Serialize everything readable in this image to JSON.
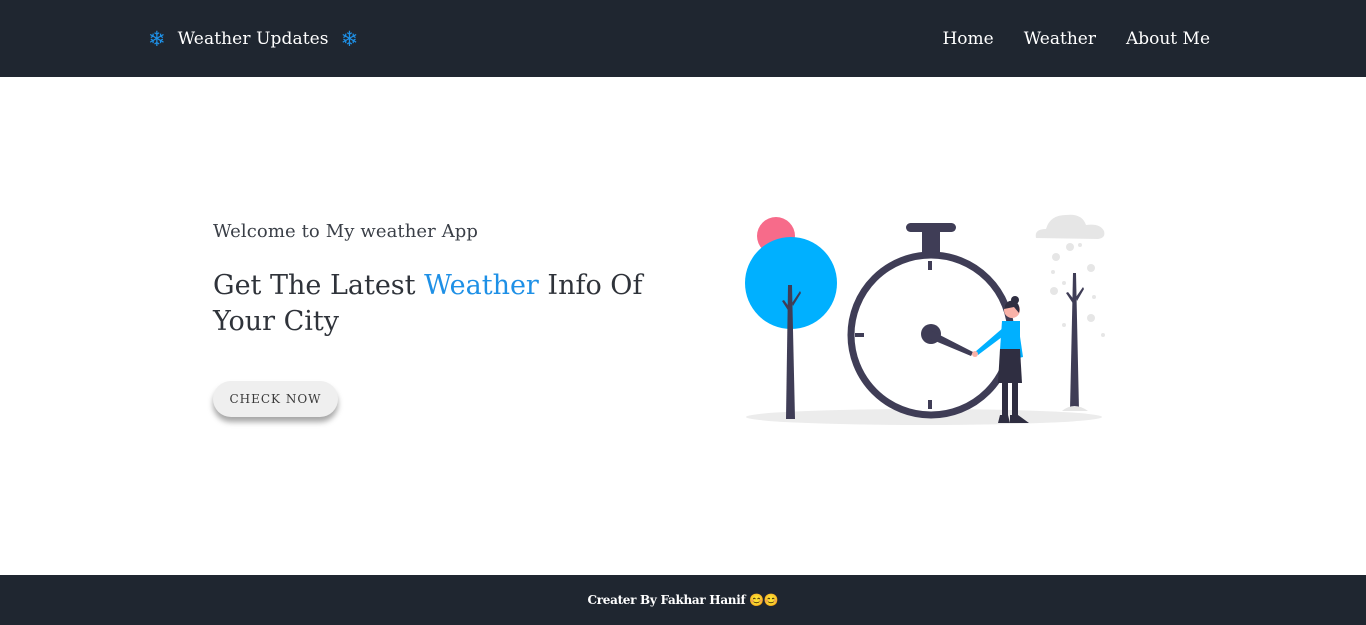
{
  "header": {
    "brand_icon": "snowflake-icon",
    "brand_icon_glyph": "❄",
    "brand_title": "Weather Updates",
    "nav": [
      {
        "label": "Home"
      },
      {
        "label": "Weather"
      },
      {
        "label": "About Me"
      }
    ]
  },
  "hero": {
    "welcome": "Welcome to My weather App",
    "headline_part1": "Get The Latest ",
    "headline_accent": "Weather",
    "headline_part2": " Info Of Your City",
    "button_label": "CHECK NOW",
    "illustration": "stopwatch-with-woman-and-trees-illustration"
  },
  "footer": {
    "text": "Creater By Fakhar Hanif 😊😊"
  },
  "colors": {
    "nav_background": "#1f2630",
    "accent": "#1e90e6",
    "illustration_blue": "#00b0ff",
    "illustration_pink": "#f76b8a",
    "illustration_dark": "#3f3d56"
  }
}
